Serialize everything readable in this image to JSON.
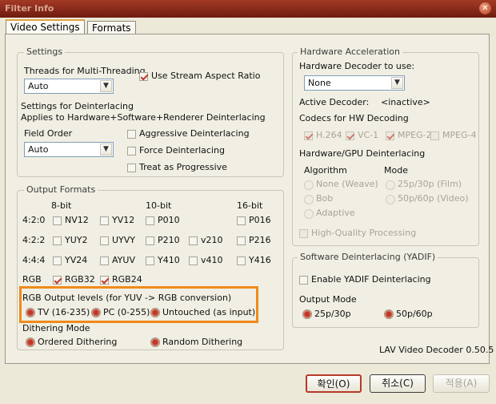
{
  "window": {
    "title": "Filter Info"
  },
  "tabs": [
    "Video Settings",
    "Formats"
  ],
  "settings": {
    "title": "Settings",
    "threads_label": "Threads for Multi-Threading",
    "threads_value": "Auto",
    "stream_aspect": "Use Stream Aspect Ratio",
    "deint_label": "Settings for Deinterlacing",
    "deint_sub": "Applies to Hardware+Software+Renderer Deinterlacing",
    "field_order_label": "Field Order",
    "field_order_value": "Auto",
    "aggressive": "Aggressive Deinterlacing",
    "force": "Force Deinterlacing",
    "progressive": "Treat as Progressive"
  },
  "output": {
    "title": "Output Formats",
    "col_8": "8-bit",
    "col_10": "10-bit",
    "col_16": "16-bit",
    "rows": [
      {
        "label": "4:2:0",
        "items": [
          "NV12",
          "YV12",
          "P010",
          "P016"
        ]
      },
      {
        "label": "4:2:2",
        "items": [
          "YUY2",
          "UYVY",
          "P210",
          "v210",
          "P216"
        ]
      },
      {
        "label": "4:4:4",
        "items": [
          "YV24",
          "AYUV",
          "Y410",
          "v410",
          "Y416"
        ]
      },
      {
        "label": "RGB",
        "items": [
          "RGB32",
          "RGB24"
        ]
      }
    ],
    "rgb_levels_label": "RGB Output levels (for YUV -> RGB conversion)",
    "rgb_levels": [
      "TV (16-235)",
      "PC (0-255)",
      "Untouched (as input)"
    ],
    "dither_label": "Dithering Mode",
    "dither": [
      "Ordered Dithering",
      "Random Dithering"
    ]
  },
  "hw": {
    "title": "Hardware Acceleration",
    "decoder_label": "Hardware Decoder to use:",
    "decoder_value": "None",
    "active_label": "Active Decoder:",
    "active_value": "<inactive>",
    "codecs_label": "Codecs for HW Decoding",
    "codecs": [
      "H.264",
      "VC-1",
      "MPEG-2",
      "MPEG-4"
    ],
    "gpu_label": "Hardware/GPU Deinterlacing",
    "algo_label": "Algorithm",
    "mode_label": "Mode",
    "algo": [
      "None (Weave)",
      "Bob",
      "Adaptive"
    ],
    "modes": [
      "25p/30p (Film)",
      "50p/60p (Video)"
    ],
    "hq": "High-Quality Processing"
  },
  "yadif": {
    "title": "Software Deinterlacing (YADIF)",
    "enable": "Enable YADIF Deinterlacing",
    "mode_label": "Output Mode",
    "modes": [
      "25p/30p",
      "50p/60p"
    ]
  },
  "version": "LAV Video Decoder 0.50.5",
  "buttons": {
    "ok": "확인(O)",
    "cancel": "취소(C)",
    "apply": "적용(A)"
  },
  "icons": {
    "dropdown": "chevron-down-icon",
    "close": "close-icon"
  }
}
